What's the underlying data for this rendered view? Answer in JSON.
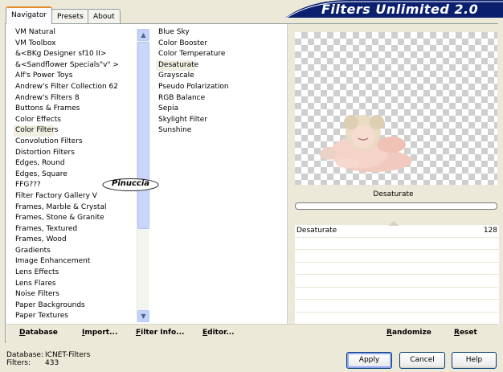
{
  "tabs": [
    "Navigator",
    "Presets",
    "About"
  ],
  "active_tab": "Navigator",
  "banner": {
    "title": "Filters Unlimited 2.0",
    "color": "#0a1f6e"
  },
  "categories": [
    "VM Natural",
    "VM Toolbox",
    "&<BKg Designer sf10 II>",
    "&<Sandflower Specials\"v\" >",
    "Alf's Power Toys",
    "Andrew's Filter Collection 62",
    "Andrew's Filters 8",
    "Buttons & Frames",
    "Color Effects",
    "Color Filters",
    "Convolution Filters",
    "Distortion Filters",
    "Edges, Round",
    "Edges, Square",
    "FFG???",
    "Filter Factory Gallery V",
    "Frames, Marble & Crystal",
    "Frames, Stone & Granite",
    "Frames, Textured",
    "Frames, Wood",
    "Gradients",
    "Image Enhancement",
    "Lens Effects",
    "Lens Flares",
    "Noise Filters",
    "Paper Backgrounds",
    "Paper Textures"
  ],
  "selected_category": "Color Filters",
  "filters": [
    "Blue Sky",
    "Color Booster",
    "Color Temperature",
    "Desaturate",
    "Grayscale",
    "Pseudo Polarization",
    "RGB Balance",
    "Sepia",
    "Skylight Filter",
    "Sunshine"
  ],
  "selected_filter": "Desaturate",
  "watermark": "Pinuccia",
  "preview": {
    "caption": "Desaturate"
  },
  "controls": [
    {
      "label": "Desaturate",
      "value": "128"
    }
  ],
  "bottom_bar": {
    "database": "Database",
    "import": "Import...",
    "filter_info": "Filter Info...",
    "editor": "Editor...",
    "randomize": "Randomize",
    "reset": "Reset"
  },
  "status": {
    "database_label": "Database:",
    "database_value": "ICNET-Filters",
    "filters_label": "Filters:",
    "filters_value": "433"
  },
  "buttons": {
    "apply": "Apply",
    "cancel": "Cancel",
    "help": "Help"
  },
  "icons": {
    "scroll_up": "▲",
    "scroll_down": "▼"
  }
}
